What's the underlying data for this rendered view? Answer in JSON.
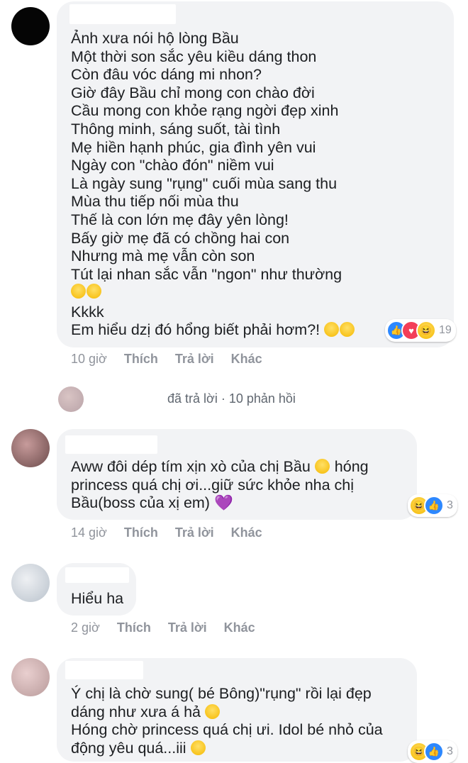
{
  "comments": [
    {
      "text": "Ảnh xưa nói hộ lòng Bầu\nMột thời son sắc yêu kiều dáng thon\nCòn đâu vóc dáng mi nhon?\nGiờ đây Bầu chỉ mong con chào đời\nCầu mong con khỏe rạng ngời đẹp xinh\nThông minh, sáng suốt, tài tình\nMẹ hiền hạnh phúc, gia đình yên vui\nNgày con \"chào đón\" niềm vui\nLà ngày sung \"rụng\" cuối mùa sang thu\nMùa thu tiếp nối mùa thu\nThế là con lớn mẹ đây yên lòng!\nBấy giờ mẹ đã có chồng hai con\nNhưng mà mẹ vẫn còn son\nTút lại nhan sắc vẫn \"ngon\" như thường",
      "line2": "Kkkk",
      "line3": "Em hiểu dzị đó hổng biết phải hơm?!",
      "reactions": {
        "icons": [
          "like-icon",
          "love-icon",
          "haha-icon"
        ],
        "count": "19"
      },
      "time": "10 giờ",
      "like": "Thích",
      "reply": "Trả lời",
      "more": "Khác"
    },
    {
      "text": "Aww đôi dép tím xịn xò của chị Bầu",
      "text_b": "hóng princess quá chị ơi...giữ sức khỏe nha chị Bầu(boss của xị em)",
      "reactions": {
        "icons": [
          "haha-icon",
          "like-icon"
        ],
        "count": "3"
      },
      "time": "14 giờ",
      "like": "Thích",
      "reply": "Trả lời",
      "more": "Khác"
    },
    {
      "text": "Hiểu ha",
      "time": "2 giờ",
      "like": "Thích",
      "reply": "Trả lời",
      "more": "Khác"
    },
    {
      "text": "Ý chị là chờ sung( bé Bông)\"rụng\" rồi lại đẹp dáng như xưa á hả",
      "text_b": "Hóng chờ princess quá chị ưi. Idol bé nhỏ của động yêu quá...iii",
      "reactions": {
        "icons": [
          "haha-icon",
          "like-icon"
        ],
        "count": "3"
      }
    }
  ],
  "replies_summary": "đã trả lời · 10 phản hồi"
}
